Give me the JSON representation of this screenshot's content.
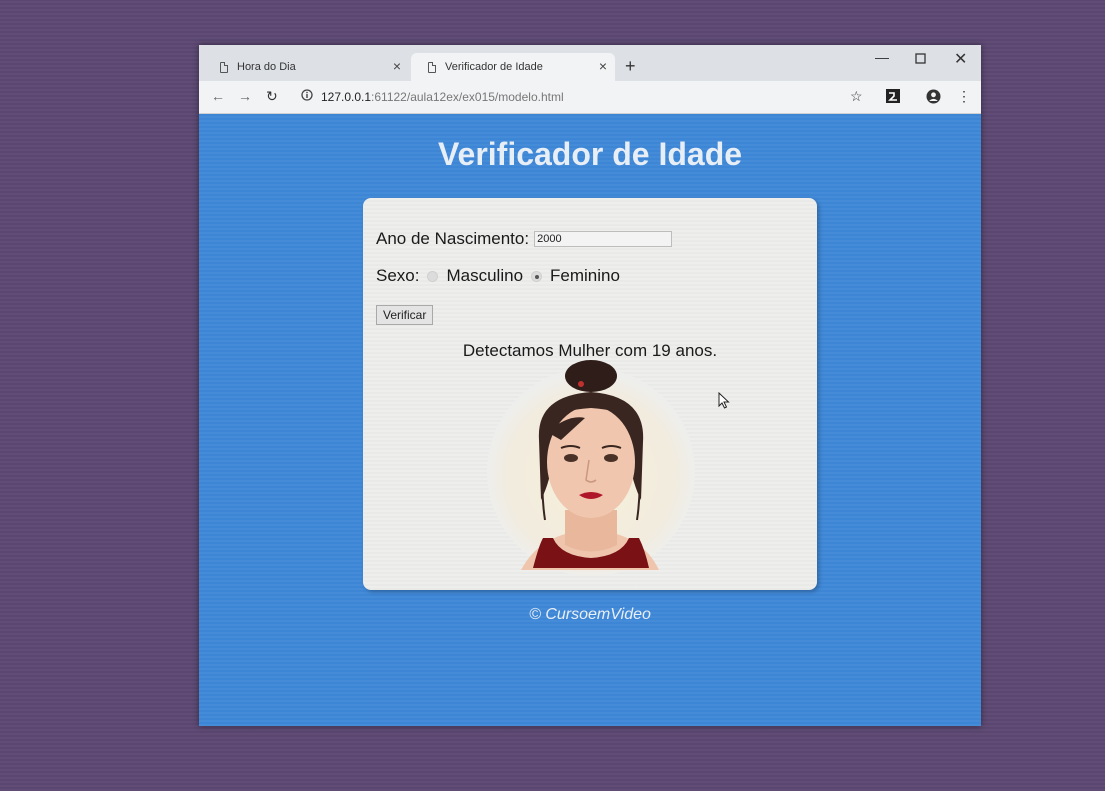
{
  "browser": {
    "tabs": [
      {
        "title": "Hora do Dia"
      },
      {
        "title": "Verificador de Idade"
      }
    ],
    "url_host": "127.0.0.1",
    "url_rest": ":61122/aula12ex/ex015/modelo.html"
  },
  "page": {
    "title": "Verificador de Idade",
    "form": {
      "year_label": "Ano de Nascimento:",
      "year_value": "2000",
      "sex_label": "Sexo:",
      "option_male": "Masculino",
      "option_female": "Feminino",
      "selected": "Feminino",
      "button": "Verificar"
    },
    "result": "Detectamos Mulher com 19 anos.",
    "footer": "© CursoemVideo"
  },
  "colors": {
    "page_bg": "#3d86d6",
    "card_bg": "#eeeeec",
    "title_text": "#e8eef6"
  }
}
